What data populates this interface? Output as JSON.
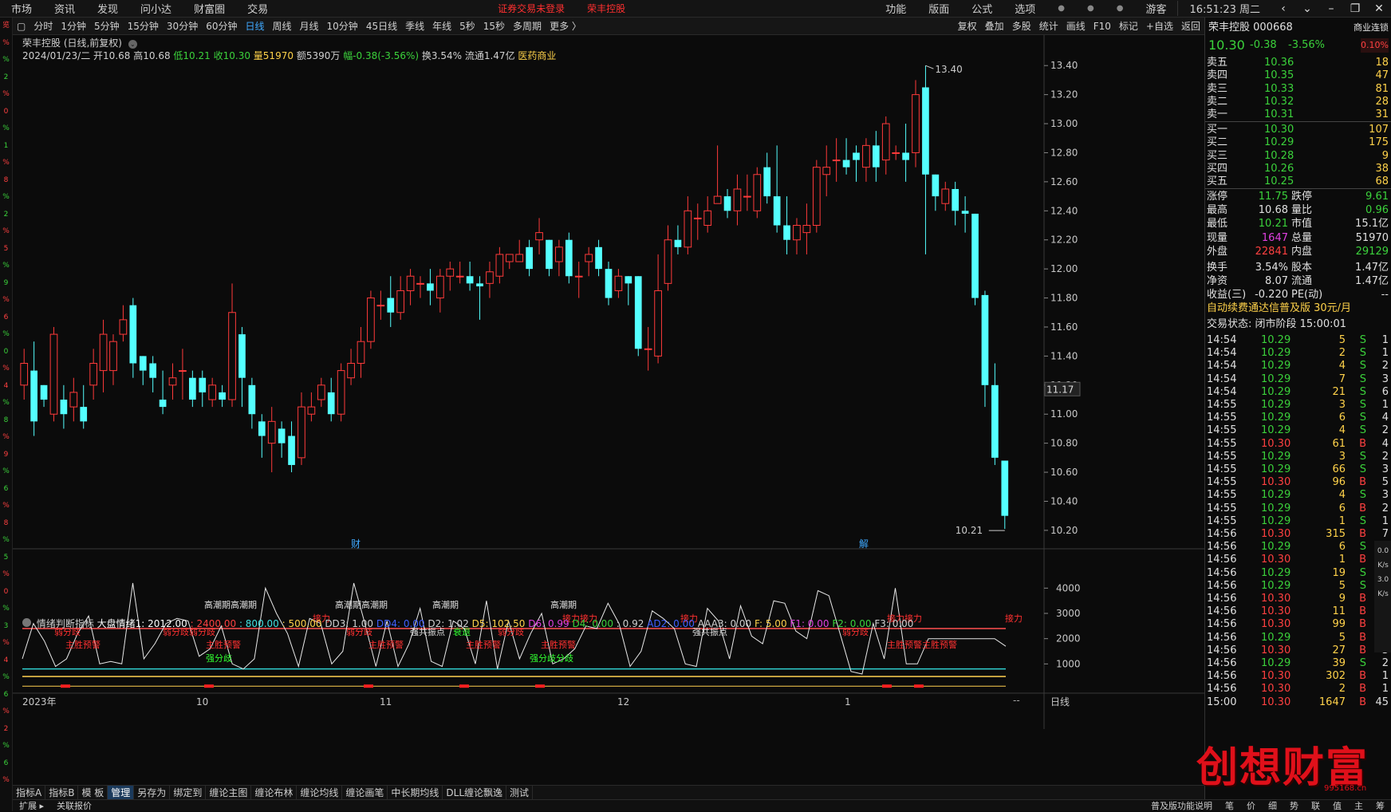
{
  "menu": {
    "items": [
      "市场",
      "资讯",
      "发现",
      "问小达",
      "财富圈",
      "交易"
    ],
    "notice": "证券交易未登录",
    "notice_stock": "荣丰控股",
    "right_items": [
      "功能",
      "版面",
      "公式",
      "选项"
    ],
    "user": "游客",
    "clock": "16:51:23 周二"
  },
  "left_rail": [
    "览",
    "%",
    "%",
    "2",
    "%",
    "0",
    "%",
    "1",
    "%",
    "8",
    "%",
    "2",
    "%",
    "5",
    "%",
    "9",
    "%",
    "6",
    "%",
    "0",
    "%",
    "4",
    "%",
    "8",
    "%",
    "9",
    "%",
    "6",
    "%",
    "8",
    "%",
    "5",
    "%",
    "0",
    "%",
    "3",
    "%",
    "4",
    "%",
    "6",
    "%",
    "2",
    "%",
    "6",
    "%",
    "2",
    "%",
    "5",
    "%",
    "2",
    "%",
    "4",
    "%"
  ],
  "toolbar": {
    "periods": [
      "分时",
      "1分钟",
      "5分钟",
      "15分钟",
      "30分钟",
      "60分钟",
      "日线",
      "周线",
      "月线",
      "10分钟",
      "45日线",
      "季线",
      "年线",
      "5秒",
      "15秒",
      "多周期",
      "更多 〉"
    ],
    "active": "日线",
    "right_tools": [
      "复权",
      "叠加",
      "多股",
      "统计",
      "画线",
      "F10",
      "标记",
      "+自选",
      "返回"
    ]
  },
  "chart": {
    "title": "荣丰控股 (日线,前复权)",
    "date": "2024/01/23/二",
    "open_label": "开10.68",
    "high_label": "高10.68",
    "low_label": "低10.21",
    "close_label": "收10.30",
    "vol_label": "量51970",
    "amount_label": "额5390万",
    "change_label": "幅-0.38(-3.56%)",
    "turnover_label": "换3.54%",
    "float_label": "流通1.47亿",
    "sector": "医药商业",
    "max_label": "13.40",
    "min_label": "10.21",
    "cross_price": "11.17",
    "marker_cai": "财",
    "marker_jie": "解",
    "month_labels": [
      "2023年",
      "10",
      "11",
      "12",
      "1"
    ]
  },
  "chart_data": {
    "type": "candlestick",
    "price_axis": [
      "13.40",
      "13.20",
      "13.00",
      "12.80",
      "12.60",
      "12.40",
      "12.20",
      "12.00",
      "11.80",
      "11.60",
      "11.40",
      "11.20",
      "11.00",
      "10.80",
      "10.60",
      "10.40",
      "10.20"
    ],
    "ylim": [
      10.15,
      13.5
    ],
    "candles": [
      [
        11.2,
        11.35,
        11.45,
        11.1
      ],
      [
        11.3,
        10.95,
        11.5,
        10.85
      ],
      [
        11.2,
        11.1,
        11.2,
        11.05
      ],
      [
        11.0,
        11.55,
        11.6,
        10.95
      ],
      [
        11.1,
        11.0,
        11.2,
        10.9
      ],
      [
        11.05,
        11.15,
        11.25,
        10.95
      ],
      [
        11.05,
        10.95,
        11.2,
        10.9
      ],
      [
        11.2,
        11.35,
        11.45,
        11.1
      ],
      [
        11.3,
        11.55,
        11.65,
        11.15
      ],
      [
        11.3,
        11.5,
        11.55,
        11.2
      ],
      [
        11.55,
        11.65,
        11.75,
        11.5
      ],
      [
        11.75,
        11.35,
        11.8,
        11.25
      ],
      [
        11.4,
        11.3,
        11.4,
        11.2
      ],
      [
        11.35,
        11.25,
        11.4,
        11.15
      ],
      [
        11.1,
        11.05,
        11.3,
        11.0
      ],
      [
        11.2,
        11.25,
        11.35,
        11.1
      ],
      [
        11.3,
        11.3,
        11.45,
        11.1
      ],
      [
        11.25,
        11.1,
        11.3,
        11.05
      ],
      [
        11.25,
        11.15,
        11.3,
        11.05
      ],
      [
        11.1,
        11.2,
        11.25,
        11.05
      ],
      [
        11.15,
        11.1,
        11.2,
        11.05
      ],
      [
        11.1,
        11.7,
        11.9,
        11.05
      ],
      [
        11.55,
        11.25,
        11.6,
        11.05
      ],
      [
        11.2,
        11.0,
        11.25,
        10.9
      ],
      [
        10.95,
        10.85,
        11.0,
        10.7
      ],
      [
        10.8,
        10.95,
        11.05,
        10.6
      ],
      [
        10.9,
        10.8,
        10.95,
        10.7
      ],
      [
        10.85,
        10.65,
        10.95,
        10.6
      ],
      [
        10.7,
        11.05,
        11.15,
        10.65
      ],
      [
        11.0,
        11.05,
        11.15,
        10.95
      ],
      [
        11.1,
        11.2,
        11.25,
        11.05
      ],
      [
        11.15,
        11.0,
        11.25,
        10.95
      ],
      [
        11.0,
        11.3,
        11.35,
        10.95
      ],
      [
        11.25,
        11.35,
        11.45,
        11.2
      ],
      [
        11.35,
        11.5,
        11.6,
        11.25
      ],
      [
        11.5,
        11.8,
        11.85,
        11.45
      ],
      [
        11.75,
        11.75,
        11.85,
        11.65
      ],
      [
        11.8,
        11.7,
        11.95,
        11.6
      ],
      [
        11.7,
        11.85,
        11.95,
        11.65
      ],
      [
        11.85,
        11.95,
        12.0,
        11.75
      ],
      [
        11.9,
        11.9,
        11.95,
        11.8
      ],
      [
        11.9,
        11.85,
        12.0,
        11.75
      ],
      [
        11.8,
        11.95,
        12.0,
        11.7
      ],
      [
        11.95,
        12.0,
        12.05,
        11.85
      ],
      [
        11.95,
        11.95,
        12.05,
        11.9
      ],
      [
        11.95,
        11.9,
        12.05,
        11.85
      ],
      [
        11.9,
        11.88,
        11.95,
        11.65
      ],
      [
        11.9,
        11.98,
        12.05,
        11.8
      ],
      [
        11.95,
        12.1,
        12.15,
        11.9
      ],
      [
        12.05,
        12.1,
        12.1,
        12.0
      ],
      [
        12.05,
        12.1,
        12.2,
        12.05
      ],
      [
        12.15,
        12.0,
        12.2,
        11.95
      ],
      [
        12.2,
        12.25,
        12.35,
        12.1
      ],
      [
        12.2,
        12.0,
        12.2,
        11.95
      ],
      [
        12.05,
        12.15,
        12.2,
        11.95
      ],
      [
        12.2,
        11.95,
        12.25,
        11.9
      ],
      [
        11.95,
        11.95,
        12.05,
        11.8
      ],
      [
        12.05,
        12.1,
        12.15,
        11.95
      ],
      [
        12.15,
        12.0,
        12.2,
        11.95
      ],
      [
        12.0,
        11.8,
        12.05,
        11.75
      ],
      [
        11.85,
        11.95,
        12.0,
        11.8
      ],
      [
        11.95,
        11.9,
        11.95,
        11.75
      ],
      [
        11.95,
        11.45,
        11.95,
        11.4
      ],
      [
        11.45,
        11.45,
        11.6,
        11.3
      ],
      [
        11.4,
        11.85,
        12.1,
        11.35
      ],
      [
        11.9,
        12.2,
        12.3,
        11.85
      ],
      [
        12.2,
        12.15,
        12.3,
        12.1
      ],
      [
        12.15,
        12.4,
        12.5,
        12.1
      ],
      [
        12.35,
        12.35,
        12.45,
        12.2
      ],
      [
        12.3,
        12.4,
        12.5,
        12.25
      ],
      [
        12.45,
        12.5,
        12.85,
        12.45
      ],
      [
        12.5,
        12.4,
        12.55,
        12.35
      ],
      [
        12.4,
        12.55,
        12.65,
        12.3
      ],
      [
        12.5,
        12.5,
        12.65,
        12.4
      ],
      [
        12.4,
        12.65,
        12.7,
        12.35
      ],
      [
        12.7,
        12.5,
        12.8,
        12.45
      ],
      [
        12.5,
        12.3,
        12.85,
        12.25
      ],
      [
        12.3,
        12.2,
        12.5,
        12.1
      ],
      [
        12.2,
        12.3,
        12.35,
        12.1
      ],
      [
        12.25,
        12.3,
        12.45,
        12.1
      ],
      [
        12.3,
        12.7,
        12.75,
        12.25
      ],
      [
        12.65,
        12.7,
        12.85,
        12.5
      ],
      [
        12.75,
        12.75,
        12.9,
        12.6
      ],
      [
        12.75,
        12.7,
        12.9,
        12.65
      ],
      [
        12.8,
        12.75,
        12.85,
        12.6
      ],
      [
        12.7,
        12.85,
        12.9,
        12.6
      ],
      [
        12.85,
        12.7,
        12.95,
        12.6
      ],
      [
        12.75,
        13.0,
        13.05,
        12.65
      ],
      [
        12.8,
        12.8,
        12.85,
        12.75
      ],
      [
        12.8,
        12.75,
        13.0,
        12.6
      ],
      [
        12.8,
        13.2,
        13.3,
        12.7
      ],
      [
        13.25,
        12.65,
        13.4,
        12.1
      ],
      [
        12.65,
        12.5,
        12.65,
        12.4
      ],
      [
        12.45,
        12.55,
        12.6,
        12.4
      ],
      [
        12.55,
        12.4,
        12.6,
        12.3
      ],
      [
        12.4,
        12.38,
        12.5,
        12.25
      ],
      [
        12.38,
        11.8,
        12.38,
        11.75
      ],
      [
        11.82,
        11.2,
        11.85,
        11.05
      ],
      [
        11.2,
        10.7,
        11.35,
        10.65
      ],
      [
        10.68,
        10.3,
        10.68,
        10.21
      ]
    ],
    "indicator_axis": [
      "4000",
      "3000",
      "2000",
      "1000"
    ],
    "indicator_line": [
      1200,
      2600,
      1900,
      900,
      1200,
      2200,
      2900,
      1000,
      1100,
      1000,
      4200,
      1200,
      1800,
      2600,
      2800,
      2700,
      1300,
      1600,
      2500,
      1000,
      800,
      1200,
      4000,
      3000,
      2200,
      900,
      2800,
      2600,
      1000,
      1500,
      4200,
      2600,
      900,
      2700,
      900,
      1800,
      3200,
      1100,
      900,
      2700,
      2400,
      1000,
      3500,
      800,
      2700,
      1200,
      2200,
      3000,
      1000,
      1200,
      1600,
      2500,
      2400,
      3400,
      2600,
      900,
      1500,
      3100,
      2800,
      2400,
      1000,
      900,
      3200,
      2700,
      1200,
      3300,
      2100,
      1800,
      3500,
      3400,
      2300,
      2000,
      3900,
      3700,
      2200,
      700,
      600,
      2600,
      1200,
      4000,
      1000,
      1000,
      2000,
      2000,
      2000,
      2000,
      2000,
      2000,
      2000,
      1700
    ],
    "indicator_labels": [
      {
        "text": "弱分歧",
        "color": "red"
      },
      {
        "text": "主胜预警",
        "color": "red"
      },
      {
        "text": "弱分歧弱分歧",
        "color": "red"
      },
      {
        "text": "高潮期高潮期",
        "color": "white"
      },
      {
        "text": "主胜预警",
        "color": "red"
      },
      {
        "text": "强分歧",
        "color": "green"
      },
      {
        "text": "接力",
        "color": "red"
      },
      {
        "text": "高潮期高潮期",
        "color": "white"
      },
      {
        "text": "弱分歧",
        "color": "red"
      },
      {
        "text": "主胜预警",
        "color": "red"
      },
      {
        "text": "强共振点",
        "color": "white"
      },
      {
        "text": "高潮期",
        "color": "white"
      },
      {
        "text": "衰退",
        "color": "green"
      },
      {
        "text": "主胜预警",
        "color": "red"
      },
      {
        "text": "弱分歧",
        "color": "red"
      },
      {
        "text": "高潮期",
        "color": "white"
      },
      {
        "text": "接力接力",
        "color": "red"
      },
      {
        "text": "主胜预警",
        "color": "red"
      },
      {
        "text": "强分歧分歧",
        "color": "green"
      },
      {
        "text": "接力",
        "color": "red"
      },
      {
        "text": "强共振点",
        "color": "white"
      },
      {
        "text": "弱分歧",
        "color": "red"
      },
      {
        "text": "接力接力",
        "color": "red"
      },
      {
        "text": "主胜预警主胜预警",
        "color": "red"
      },
      {
        "text": "接力",
        "color": "red"
      }
    ]
  },
  "indicator": {
    "name": "情绪判断指标",
    "t1": "大盘情绪1: 2012.00",
    "t2": ": 2400.00",
    "t3": ": 800.00",
    "t4": ": 500.00",
    "t5": "DD3: 1.00",
    "t6": "DD4: 0.00",
    "t7": "D2: 1.02",
    "t8": "D5: 102.50",
    "t9": "D6: 0.99",
    "t10": "D4: 0.00",
    "t11": ": 0.92",
    "t12": "AD2: 0.00",
    "t13": "AAA3: 0.00",
    "t14": "F: 5.00",
    "t15": "F1: 0.00",
    "t16": "F2: 0.00",
    "t17": "F3: 0.00"
  },
  "bottom_tabs": [
    "指标A",
    "指标B",
    "模 板",
    "管理",
    "另存为",
    "绑定到",
    "缠论主图",
    "缠论布林",
    "缠论均线",
    "缠论画笔",
    "中长期均线",
    "DLL缠论飘逸",
    "测试"
  ],
  "bottom_active": "管理",
  "status_bar": {
    "left": [
      "扩展 ▸",
      "关联报价"
    ],
    "period": "日线",
    "right_help": "普及版功能说明",
    "right_tabs": [
      "笔",
      "价",
      "细",
      "势",
      "联",
      "值",
      "主",
      "筹"
    ]
  },
  "quote": {
    "name": "荣丰控股",
    "code": "000668",
    "service": "商业连锁",
    "price": "10.30",
    "change": "-0.38",
    "pct": "-3.56%",
    "rate": "0.10%",
    "asks": [
      [
        "卖五",
        "10.36",
        "18"
      ],
      [
        "卖四",
        "10.35",
        "47"
      ],
      [
        "卖三",
        "10.33",
        "81"
      ],
      [
        "卖二",
        "10.32",
        "28"
      ],
      [
        "卖一",
        "10.31",
        "31"
      ]
    ],
    "bids": [
      [
        "买一",
        "10.30",
        "107"
      ],
      [
        "买二",
        "10.29",
        "175"
      ],
      [
        "买三",
        "10.28",
        "9"
      ],
      [
        "买四",
        "10.26",
        "38"
      ],
      [
        "买五",
        "10.25",
        "68"
      ]
    ],
    "stats": [
      [
        "涨停",
        "11.75",
        "跌停",
        "9.61"
      ],
      [
        "最高",
        "10.68",
        "量比",
        "0.96"
      ],
      [
        "最低",
        "10.21",
        "市值",
        "15.1亿"
      ],
      [
        "现量",
        "1647",
        "总量",
        "51970"
      ],
      [
        "外盘",
        "22841",
        "内盘",
        "29129"
      ],
      [
        "换手",
        "3.54%",
        "股本",
        "1.47亿"
      ],
      [
        "净资",
        "8.07",
        "流通",
        "1.47亿"
      ],
      [
        "收益(三)",
        "-0.220",
        "PE(动)",
        "--"
      ]
    ],
    "promo": "自动续费通达信普及版  30元/月",
    "trade_state": "交易状态: 闭市阶段 15:00:01",
    "ticks": [
      [
        "14:54",
        "10.29",
        "5",
        "S",
        "1"
      ],
      [
        "14:54",
        "10.29",
        "2",
        "S",
        "1"
      ],
      [
        "14:54",
        "10.29",
        "4",
        "S",
        "2"
      ],
      [
        "14:54",
        "10.29",
        "7",
        "S",
        "3"
      ],
      [
        "14:54",
        "10.29",
        "21",
        "S",
        "6"
      ],
      [
        "14:55",
        "10.29",
        "3",
        "S",
        "1"
      ],
      [
        "14:55",
        "10.29",
        "6",
        "S",
        "4"
      ],
      [
        "14:55",
        "10.29",
        "4",
        "S",
        "2"
      ],
      [
        "14:55",
        "10.30",
        "61",
        "B",
        "4"
      ],
      [
        "14:55",
        "10.29",
        "3",
        "S",
        "2"
      ],
      [
        "14:55",
        "10.29",
        "66",
        "S",
        "3"
      ],
      [
        "14:55",
        "10.30",
        "96",
        "B",
        "5"
      ],
      [
        "14:55",
        "10.29",
        "4",
        "S",
        "3"
      ],
      [
        "14:55",
        "10.29",
        "6",
        "B",
        "2"
      ],
      [
        "14:55",
        "10.29",
        "1",
        "S",
        "1"
      ],
      [
        "14:56",
        "10.30",
        "315",
        "B",
        "7"
      ],
      [
        "14:56",
        "10.29",
        "6",
        "S",
        "4"
      ],
      [
        "14:56",
        "10.30",
        "1",
        "B",
        "1"
      ],
      [
        "14:56",
        "10.29",
        "19",
        "S",
        "8"
      ],
      [
        "14:56",
        "10.29",
        "5",
        "S",
        "4"
      ],
      [
        "14:56",
        "10.30",
        "9",
        "B",
        "6"
      ],
      [
        "14:56",
        "10.30",
        "11",
        "B",
        "9"
      ],
      [
        "14:56",
        "10.30",
        "99",
        "B",
        "8"
      ],
      [
        "14:56",
        "10.29",
        "5",
        "B",
        "4"
      ],
      [
        "14:56",
        "10.30",
        "27",
        "B",
        "3"
      ],
      [
        "14:56",
        "10.29",
        "39",
        "S",
        "2"
      ],
      [
        "14:56",
        "10.30",
        "302",
        "B",
        "1"
      ],
      [
        "14:56",
        "10.30",
        "2",
        "B",
        "1"
      ],
      [
        "15:00",
        "10.30",
        "1647",
        "B",
        "45"
      ]
    ],
    "side_widget": [
      "0.0",
      "K/s",
      "3.0",
      "K/s"
    ]
  },
  "watermark": "创想财富",
  "watermark_url": "995168.cn"
}
